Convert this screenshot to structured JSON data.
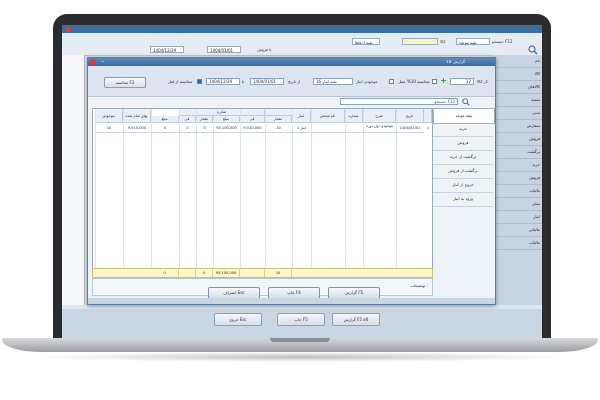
{
  "background_window": {
    "toolbar": {
      "search_label": "جستجو F12",
      "profile_label": "بقیه موعید",
      "account_label": "کالا",
      "period_label": "بقیه ادعاها",
      "from_date": "1404/01/01",
      "to_date": "1404/12/29",
      "check_label": "تا فروش",
      "title_right": "گروه"
    },
    "right_items": [
      "نام",
      "کالا",
      "کالاهای",
      "شعبه",
      "مدیر",
      "سفارش",
      "فروش",
      "برگشت",
      "خرید",
      "فروش",
      "مالیات",
      "سایر",
      "انبار",
      "مالیاتی",
      "مالیات"
    ],
    "bottom_buttons": [
      "گزارش F5 alt",
      "چاپ F5",
      "خروج Esc"
    ]
  },
  "dialog": {
    "title": "گزارش کالا",
    "calc_button": "محاسبه F2",
    "filter": {
      "from_code_label": "از کالا:",
      "from_code_value": "12",
      "tax_label": "محاسبه 10% عمل",
      "to_label": "تا",
      "inventory_label": "موجودی انبار",
      "inventory_value": "بقیه انبار 16",
      "from_date_label": "از تاریخ",
      "from_date": "1404/01/01",
      "to_date_label": "تا",
      "to_date": "1404/12/29",
      "calc_label": "محاسبه از قبل",
      "calc_checked": true
    },
    "search_placeholder": "جستجو F12",
    "sidebar": [
      "بقیه موعد",
      "خرید",
      "فروش",
      "برگشت از خرید",
      "برگشت از فروش",
      "خروج از انبار",
      "ورود به انبار"
    ],
    "table": {
      "group_headers": {
        "in": "وارده",
        "out": "صادره"
      },
      "headers": [
        "تاریخ",
        "شرح",
        "شماره",
        "نام شخص",
        "انبار",
        "مقدار",
        "فی",
        "مبلغ",
        "مقدار",
        "فی",
        "مبلغ",
        "بهای تمام شده",
        "موجودی"
      ],
      "rows": [
        [
          "1404/01/01",
          "موجودی اول دوره",
          "",
          "",
          "انبار 1",
          "10",
          "9,510,000",
          "95,100,000",
          "0",
          "0",
          "0",
          "9,510,000",
          "10"
        ]
      ],
      "row_number": "1",
      "totals": [
        "10",
        "",
        "95,100,000",
        "0",
        "",
        "0"
      ]
    },
    "notes_label": "توضیحات :",
    "buttons": {
      "report": "گزارش F5",
      "print": "چاپ F4",
      "exit": "انصراف Esc"
    }
  }
}
